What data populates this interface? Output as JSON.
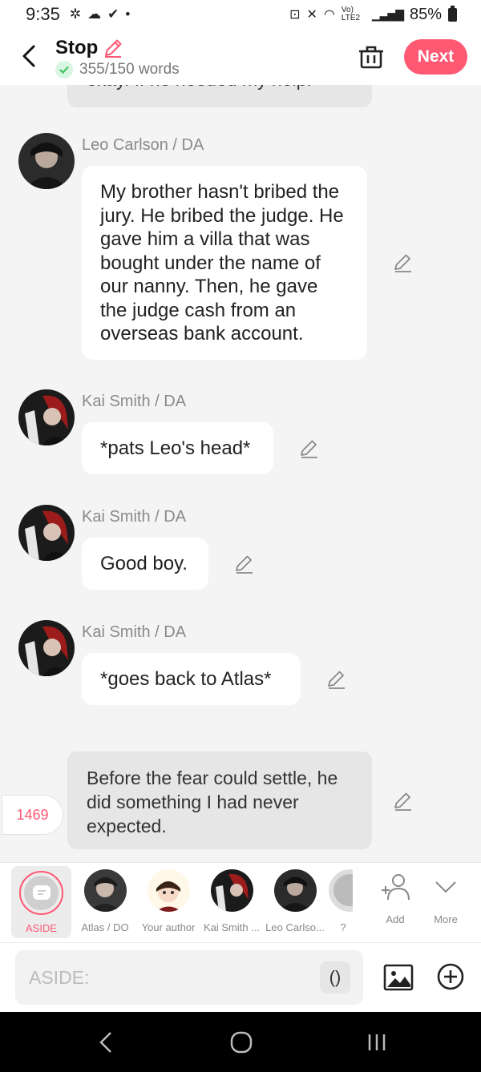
{
  "status": {
    "time": "9:35",
    "battery": "85%",
    "network": "Vo) LTE2"
  },
  "header": {
    "title": "Stop",
    "word_count": "355/150 words",
    "next_label": "Next"
  },
  "chat": {
    "narration_top": "okay. If he needed my help.",
    "messages": [
      {
        "sender": "Leo Carlson / DA",
        "text": "My brother hasn't bribed the jury. He bribed the judge. He gave him a villa that was bought under the name of our nanny. Then, he gave the judge cash from an overseas bank account."
      },
      {
        "sender": "Kai Smith / DA",
        "text": "*pats Leo's head*"
      },
      {
        "sender": "Kai Smith / DA",
        "text": "Good boy."
      },
      {
        "sender": "Kai Smith / DA",
        "text": "*goes back to Atlas*"
      }
    ],
    "narration_bottom": "Before the fear could settle, he did something I had never expected.",
    "counter": "1469"
  },
  "characters": {
    "aside_label": "ASIDE",
    "items": [
      {
        "label": "Atlas / DO"
      },
      {
        "label": "Your author"
      },
      {
        "label": "Kai Smith ..."
      },
      {
        "label": "Leo Carlso..."
      },
      {
        "label": "?"
      }
    ],
    "add_label": "Add",
    "more_label": "More"
  },
  "input": {
    "placeholder": "ASIDE:",
    "paren_label": "()"
  },
  "colors": {
    "accent": "#ff5873",
    "bubble": "#ffffff",
    "narration": "#e6e6e6",
    "background": "#f4f4f4"
  }
}
